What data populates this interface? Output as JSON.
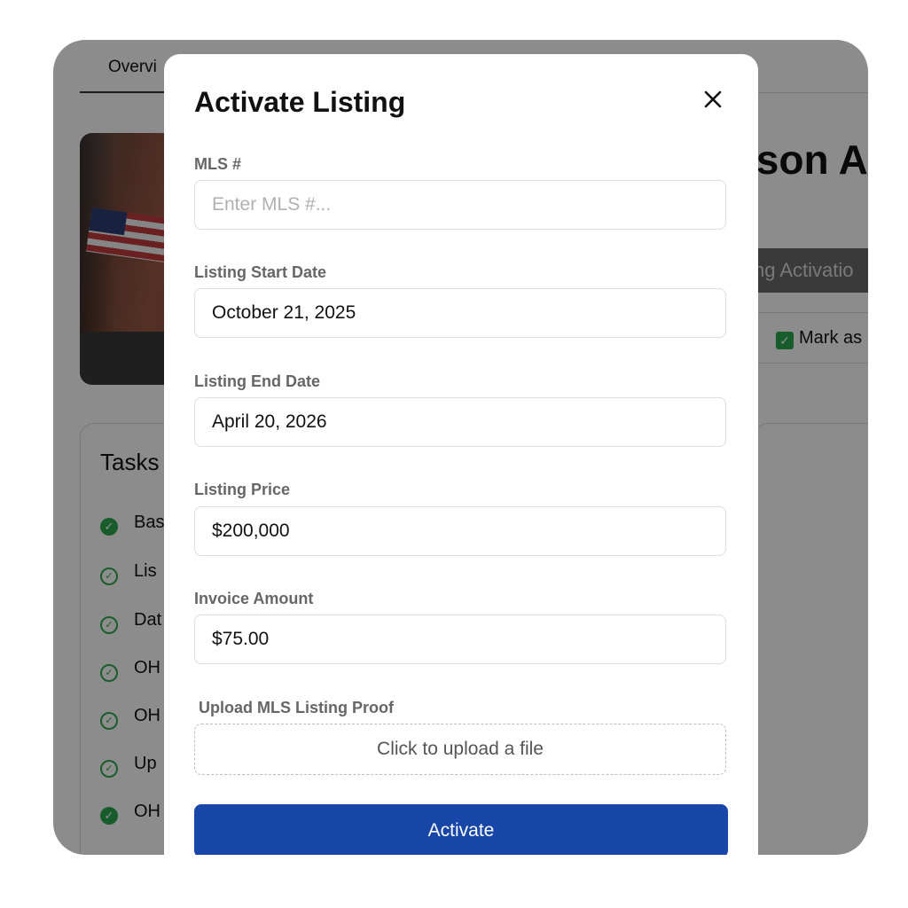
{
  "background": {
    "tab_overview": "Overvi",
    "property_title_fragment": "ison A",
    "activation_fragment": "ng Activatio",
    "mark_fragment": "Mark as",
    "tasks_title": "Tasks",
    "tasks": [
      {
        "label": "Bas",
        "status": "filled"
      },
      {
        "label": "Lis",
        "status": "outline"
      },
      {
        "label": "Dat",
        "status": "outline"
      },
      {
        "label": "OH",
        "status": "outline"
      },
      {
        "label": "OH",
        "status": "outline"
      },
      {
        "label": "Up",
        "status": "outline"
      },
      {
        "label": "OH",
        "status": "filled"
      }
    ]
  },
  "modal": {
    "title": "Activate Listing",
    "close_icon": "close-icon",
    "fields": {
      "mls": {
        "label": "MLS #",
        "placeholder": "Enter MLS #...",
        "value": ""
      },
      "start_date": {
        "label": "Listing Start Date",
        "value": "October 21, 2025"
      },
      "end_date": {
        "label": "Listing End Date",
        "value": "April 20, 2026"
      },
      "price": {
        "label": "Listing Price",
        "value": "$200,000"
      },
      "invoice": {
        "label": "Invoice Amount",
        "value": "$75.00"
      }
    },
    "upload": {
      "label": "Upload MLS Listing Proof",
      "button_text": "Click to upload a file"
    },
    "submit_label": "Activate"
  },
  "colors": {
    "primary_button": "#1746a8",
    "task_check_green": "#2fa84f",
    "overlay": "rgba(0,0,0,0.45)"
  }
}
